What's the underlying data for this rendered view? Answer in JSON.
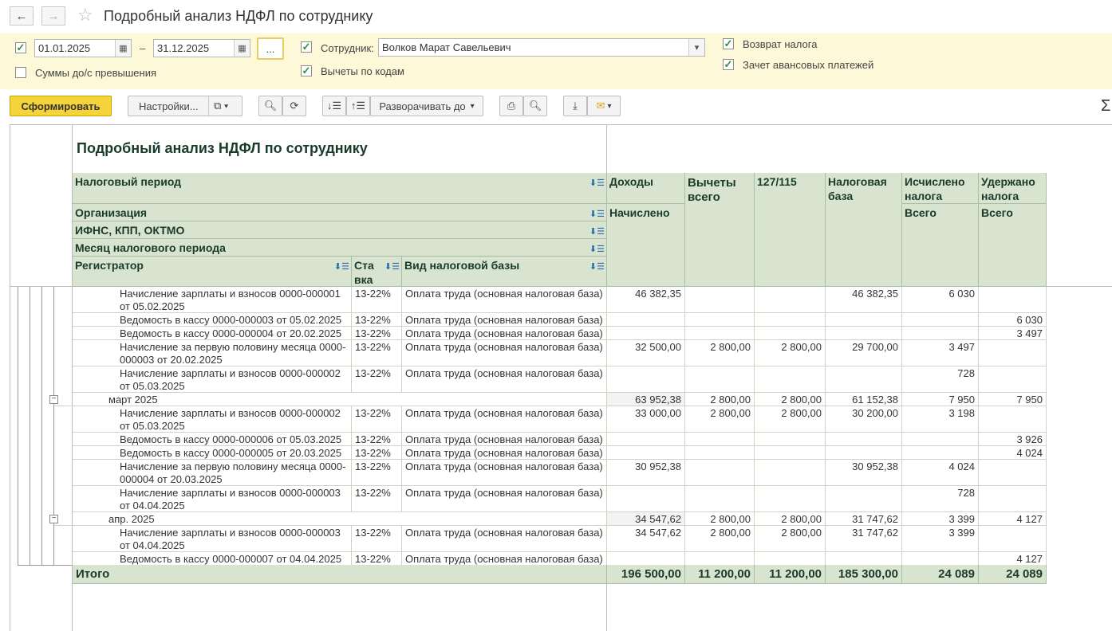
{
  "window": {
    "title": "Подробный анализ НДФЛ по сотруднику"
  },
  "filters": {
    "period_from": "01.01.2025",
    "period_dash": "–",
    "period_to": "31.12.2025",
    "period_more": "...",
    "employee_label": "Сотрудник:",
    "employee_value": "Волков Марат Савельевич",
    "sums_excess_label": "Суммы до/с превышения",
    "deductions_by_codes_label": "Вычеты по кодам",
    "tax_refund_label": "Возврат налога",
    "advance_offset_label": "Зачет авансовых платежей"
  },
  "toolbar": {
    "generate": "Сформировать",
    "settings": "Настройки...",
    "expand_to": "Разворачивать до",
    "sum_symbol": "Σ"
  },
  "report": {
    "title": "Подробный анализ НДФЛ по сотруднику",
    "headers": {
      "tax_period": "Налоговый период",
      "organization": "Организация",
      "ifns": "ИФНС, КПП, ОКТМО",
      "month": "Месяц налогового периода",
      "registrar": "Регистратор",
      "rate": "Ставка",
      "base_kind": "Вид налоговой базы",
      "income": "Доходы",
      "income_sub": "Начислено",
      "deductions": "Вычеты всего",
      "code": "127/115",
      "tax_base": "Налоговая база",
      "calculated": "Исчислено налога",
      "calculated_sub": "Всего",
      "withheld": "Удержано налога",
      "withheld_sub": "Всего"
    },
    "rows": [
      {
        "type": "doc",
        "reg": "Начисление зарплаты и взносов 0000-000001 от 05.02.2025",
        "rate": "13-22%",
        "base": "Оплата труда (основная налоговая база)",
        "inc": "46 382,35",
        "ded": "",
        "code": "",
        "tb": "46 382,35",
        "calc": "6 030",
        "with": ""
      },
      {
        "type": "doc",
        "reg": "Ведомость в кассу 0000-000003 от 05.02.2025",
        "rate": "13-22%",
        "base": "Оплата труда (основная налоговая база)",
        "inc": "",
        "ded": "",
        "code": "",
        "tb": "",
        "calc": "",
        "with": "6 030"
      },
      {
        "type": "doc",
        "reg": "Ведомость в кассу 0000-000004 от 20.02.2025",
        "rate": "13-22%",
        "base": "Оплата труда (основная налоговая база)",
        "inc": "",
        "ded": "",
        "code": "",
        "tb": "",
        "calc": "",
        "with": "3 497"
      },
      {
        "type": "doc",
        "reg": "Начисление за первую половину месяца 0000-000003 от 20.02.2025",
        "rate": "13-22%",
        "base": "Оплата труда (основная налоговая база)",
        "inc": "32 500,00",
        "ded": "2 800,00",
        "code": "2 800,00",
        "tb": "29 700,00",
        "calc": "3 497",
        "with": ""
      },
      {
        "type": "doc",
        "reg": "Начисление зарплаты и взносов 0000-000002 от 05.03.2025",
        "rate": "13-22%",
        "base": "Оплата труда (основная налоговая база)",
        "inc": "",
        "ded": "",
        "code": "",
        "tb": "",
        "calc": "728",
        "with": ""
      },
      {
        "type": "month",
        "reg": "март 2025",
        "inc": "63 952,38",
        "ded": "2 800,00",
        "code": "2 800,00",
        "tb": "61 152,38",
        "calc": "7 950",
        "with": "7 950"
      },
      {
        "type": "doc",
        "reg": "Начисление зарплаты и взносов 0000-000002 от 05.03.2025",
        "rate": "13-22%",
        "base": "Оплата труда (основная налоговая база)",
        "inc": "33 000,00",
        "ded": "2 800,00",
        "code": "2 800,00",
        "tb": "30 200,00",
        "calc": "3 198",
        "with": ""
      },
      {
        "type": "doc",
        "reg": "Ведомость в кассу 0000-000006 от 05.03.2025",
        "rate": "13-22%",
        "base": "Оплата труда (основная налоговая база)",
        "inc": "",
        "ded": "",
        "code": "",
        "tb": "",
        "calc": "",
        "with": "3 926"
      },
      {
        "type": "doc",
        "reg": "Ведомость в кассу 0000-000005 от 20.03.2025",
        "rate": "13-22%",
        "base": "Оплата труда (основная налоговая база)",
        "inc": "",
        "ded": "",
        "code": "",
        "tb": "",
        "calc": "",
        "with": "4 024"
      },
      {
        "type": "doc",
        "reg": "Начисление за первую половину месяца 0000-000004 от 20.03.2025",
        "rate": "13-22%",
        "base": "Оплата труда (основная налоговая база)",
        "inc": "30 952,38",
        "ded": "",
        "code": "",
        "tb": "30 952,38",
        "calc": "4 024",
        "with": ""
      },
      {
        "type": "doc",
        "reg": "Начисление зарплаты и взносов 0000-000003 от 04.04.2025",
        "rate": "13-22%",
        "base": "Оплата труда (основная налоговая база)",
        "inc": "",
        "ded": "",
        "code": "",
        "tb": "",
        "calc": "728",
        "with": ""
      },
      {
        "type": "month",
        "reg": "апр. 2025",
        "inc": "34 547,62",
        "ded": "2 800,00",
        "code": "2 800,00",
        "tb": "31 747,62",
        "calc": "3 399",
        "with": "4 127"
      },
      {
        "type": "doc",
        "reg": "Начисление зарплаты и взносов 0000-000003 от 04.04.2025",
        "rate": "13-22%",
        "base": "Оплата труда (основная налоговая база)",
        "inc": "34 547,62",
        "ded": "2 800,00",
        "code": "2 800,00",
        "tb": "31 747,62",
        "calc": "3 399",
        "with": ""
      },
      {
        "type": "doc",
        "reg": "Ведомость в кассу 0000-000007 от 04.04.2025",
        "rate": "13-22%",
        "base": "Оплата труда (основная налоговая база)",
        "inc": "",
        "ded": "",
        "code": "",
        "tb": "",
        "calc": "",
        "with": "4 127"
      }
    ],
    "total": {
      "label": "Итого",
      "inc": "196 500,00",
      "ded": "11 200,00",
      "code": "11 200,00",
      "tb": "185 300,00",
      "calc": "24 089",
      "with": "24 089"
    }
  }
}
